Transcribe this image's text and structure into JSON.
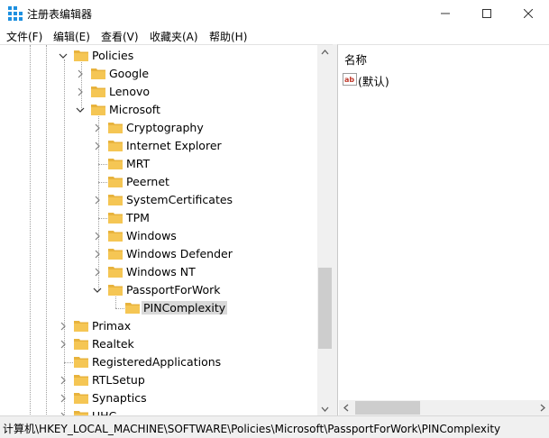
{
  "window": {
    "title": "注册表编辑器",
    "app_icon": "regedit-icon",
    "controls": [
      "minimize-icon",
      "maximize-icon",
      "close-icon"
    ]
  },
  "menu": [
    "文件(F)",
    "编辑(E)",
    "查看(V)",
    "收藏夹(A)",
    "帮助(H)"
  ],
  "tree": {
    "items": [
      {
        "label": "Policies",
        "expander": "expanded"
      },
      {
        "label": "Google",
        "expander": "collapsed"
      },
      {
        "label": "Lenovo",
        "expander": "collapsed"
      },
      {
        "label": "Microsoft",
        "expander": "expanded"
      },
      {
        "label": "Cryptography",
        "expander": "collapsed"
      },
      {
        "label": "Internet Explorer",
        "expander": "collapsed"
      },
      {
        "label": "MRT",
        "expander": "none"
      },
      {
        "label": "Peernet",
        "expander": "none"
      },
      {
        "label": "SystemCertificates",
        "expander": "collapsed"
      },
      {
        "label": "TPM",
        "expander": "none"
      },
      {
        "label": "Windows",
        "expander": "collapsed"
      },
      {
        "label": "Windows Defender",
        "expander": "collapsed"
      },
      {
        "label": "Windows NT",
        "expander": "collapsed"
      },
      {
        "label": "PassportForWork",
        "expander": "expanded"
      },
      {
        "label": "PINComplexity",
        "expander": "none",
        "selected": true
      },
      {
        "label": "Primax",
        "expander": "collapsed"
      },
      {
        "label": "Realtek",
        "expander": "collapsed"
      },
      {
        "label": "RegisteredApplications",
        "expander": "none"
      },
      {
        "label": "RTLSetup",
        "expander": "collapsed"
      },
      {
        "label": "Synaptics",
        "expander": "collapsed"
      },
      {
        "label": "UHC",
        "expander": "collapsed"
      }
    ]
  },
  "list": {
    "column_name": "名称",
    "values": [
      {
        "name": "(默认)",
        "icon": "reg-sz-icon"
      }
    ]
  },
  "status": {
    "path": "计算机\\HKEY_LOCAL_MACHINE\\SOFTWARE\\Policies\\Microsoft\\PassportForWork\\PINComplexity"
  },
  "colors": {
    "selection": "#d9d9d9",
    "folder": "#f5c654",
    "accent": "#0078d7"
  }
}
